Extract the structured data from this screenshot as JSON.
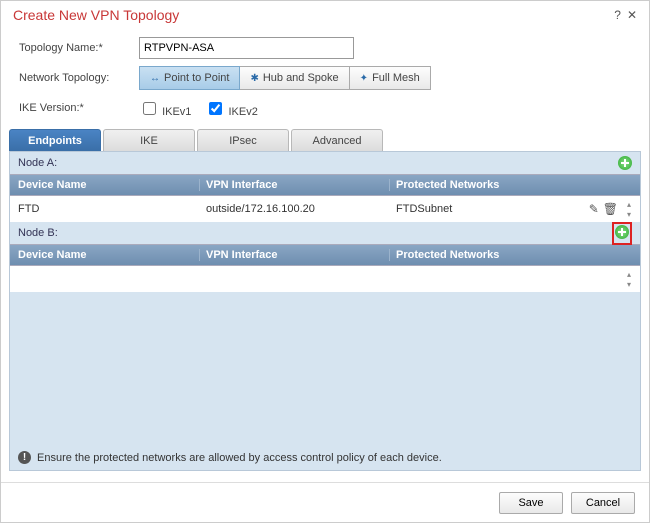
{
  "dialog": {
    "title": "Create New VPN Topology"
  },
  "form": {
    "topology_name_label": "Topology Name:*",
    "topology_name_value": "RTPVPN-ASA",
    "network_topology_label": "Network Topology:",
    "ike_version_label": "IKE Version:*",
    "ikev1_label": "IKEv1",
    "ikev2_label": "IKEv2",
    "ikev1_checked": false,
    "ikev2_checked": true
  },
  "topology_options": {
    "p2p": "Point to Point",
    "hub": "Hub and Spoke",
    "mesh": "Full Mesh"
  },
  "tabs": {
    "endpoints": "Endpoints",
    "ike": "IKE",
    "ipsec": "IPsec",
    "advanced": "Advanced"
  },
  "grid": {
    "node_a_label": "Node A:",
    "node_b_label": "Node B:",
    "headers": {
      "device": "Device Name",
      "vpn": "VPN Interface",
      "protected": "Protected Networks"
    },
    "node_a_rows": [
      {
        "device": "FTD",
        "vpn": "outside/172.16.100.20",
        "protected": "FTDSubnet"
      }
    ],
    "node_b_rows": []
  },
  "info_text": "Ensure the protected networks are allowed by access control policy of each device.",
  "buttons": {
    "save": "Save",
    "cancel": "Cancel"
  }
}
